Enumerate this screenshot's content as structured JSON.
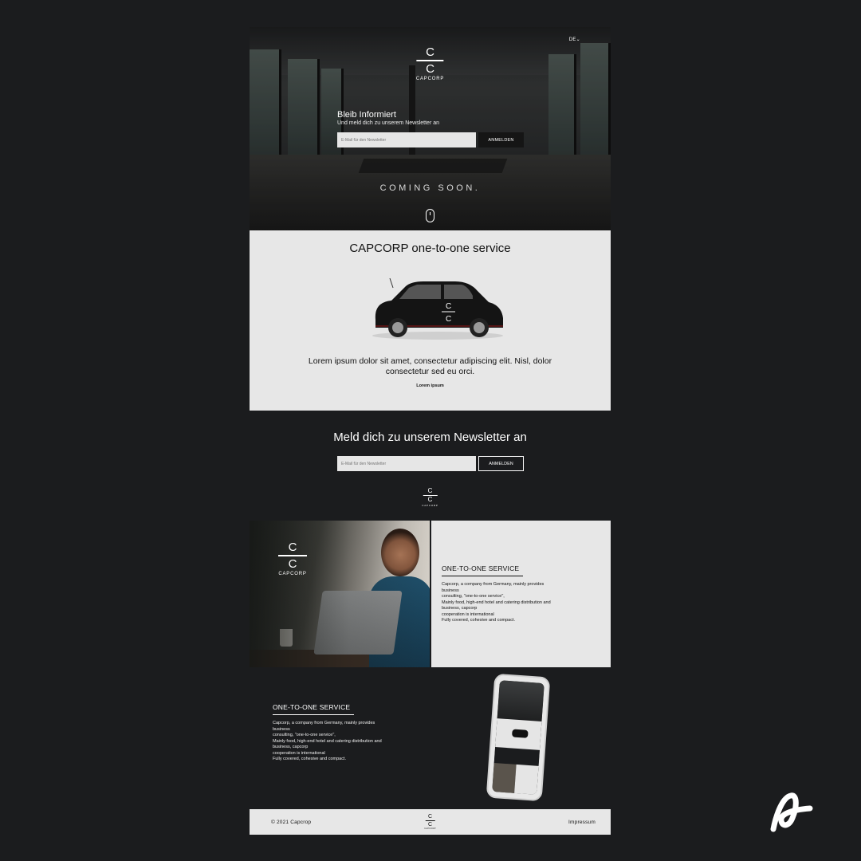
{
  "hero": {
    "lang": "DE",
    "logo_name": "CAPCORP",
    "heading": "Bleib Informiert",
    "subheading": "Und meld dich zu unserem Newsletter an",
    "email_placeholder": "E-Mail für den Newsletter",
    "button": "ANMELDEN",
    "coming_soon": "COMING SOON."
  },
  "service": {
    "title": "CAPCORP one-to-one service",
    "car_label": "CAPCORP",
    "lorem": "Lorem ipsum dolor sit amet, consectetur adipiscing elit. Nisl, dolor consectetur sed eu orci.",
    "small": "Lorem ipsum"
  },
  "newsletter": {
    "title": "Meld dich zu unserem Newsletter an",
    "email_placeholder": "E-Mail für den Newsletter",
    "button": "ANMELDEN",
    "logo_name": "CAPCORP"
  },
  "about": {
    "logo_name": "CAPCORP",
    "title": "ONE-TO-ONE SERVICE",
    "body": [
      "Capcorp, a company from Germany, mainly provides",
      "business",
      "consulting, \"one-to-one service\",",
      "Mainly food, high-end hotel and catering distribution and",
      "business, capcorp",
      "cooperation is international",
      "Fully covered, cohesive and compact."
    ]
  },
  "mobile": {
    "title": "ONE-TO-ONE SERVICE",
    "body": [
      "Capcorp, a company from Germany, mainly provides",
      "business",
      "consulting, \"one-to-one service\",",
      "Mainly food, high-end hotel and catering distribution and",
      "business, capcorp",
      "cooperation is international",
      "Fully covered, cohesive and compact."
    ]
  },
  "footer": {
    "copyright": "© 2021 Capcrop",
    "impressum": "Impressum",
    "logo_name": "CAPCORP"
  },
  "colors": {
    "background": "#1b1c1e",
    "panel": "#e7e7e7",
    "dark_button": "#151515"
  }
}
